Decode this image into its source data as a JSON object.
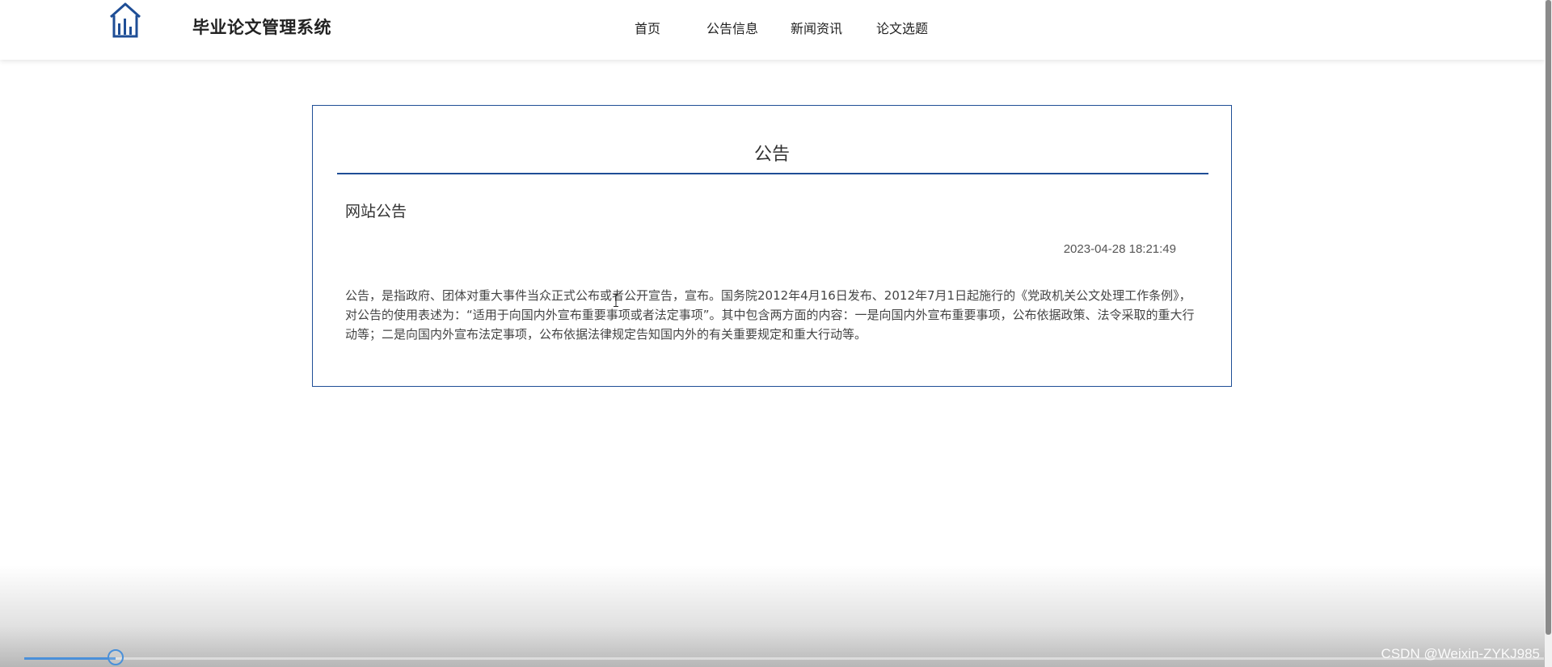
{
  "header": {
    "site_title": "毕业论文管理系统",
    "logo_icon": "house-chart-icon",
    "nav": [
      {
        "label": "首页"
      },
      {
        "label": "公告信息"
      },
      {
        "label": "新闻资讯"
      },
      {
        "label": "论文选题"
      }
    ]
  },
  "card": {
    "heading": "公告",
    "notice_title": "网站公告",
    "timestamp": "2023-04-28 18:21:49",
    "body": "公告，是指政府、团体对重大事件当众正式公布或者公开宣告，宣布。国务院2012年4月16日发布、2012年7月1日起施行的《党政机关公文处理工作条例》，对公告的使用表述为：“适用于向国内外宣布重要事项或者法定事项”。其中包含两方面的内容：一是向国内外宣布重要事项，公布依据政策、法令采取的重大行动等；二是向国内外宣布法定事项，公布依据法律规定告知国内外的有关重要规定和重大行动等。"
  },
  "player": {
    "progress": 0.06
  },
  "watermark": "CSDN @Weixin-ZYKJ985",
  "colors": {
    "accent": "#1f4e96",
    "progress": "#4a90d9"
  }
}
